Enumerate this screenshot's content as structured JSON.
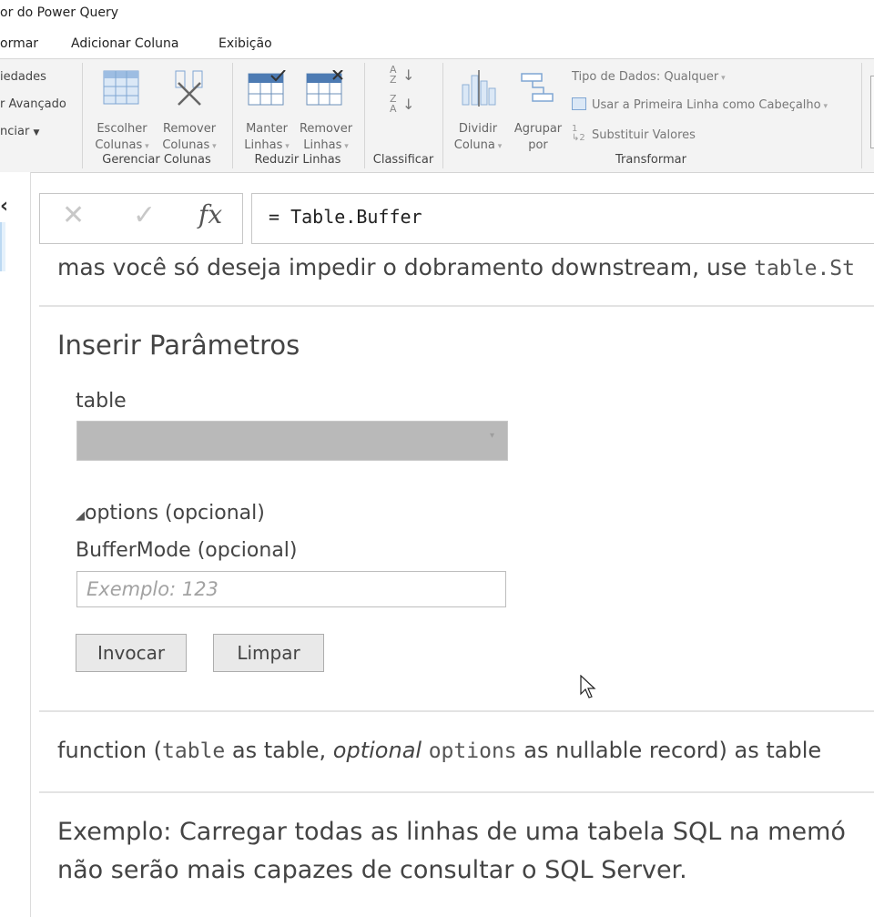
{
  "window": {
    "title": "or do Power Query"
  },
  "menu": {
    "items": [
      "ormar",
      "Adicionar Coluna",
      "Exibição"
    ]
  },
  "ribbon": {
    "left_partial": [
      "iedades",
      "r Avançado",
      "nciar"
    ],
    "choose_columns": {
      "line1": "Escolher",
      "line2": "Colunas"
    },
    "remove_columns": {
      "line1": "Remover",
      "line2": "Colunas"
    },
    "keep_rows": {
      "line1": "Manter",
      "line2": "Linhas"
    },
    "remove_rows": {
      "line1": "Remover",
      "line2": "Linhas"
    },
    "split_column": {
      "line1": "Dividir",
      "line2": "Coluna"
    },
    "group_by": {
      "line1": "Agrupar",
      "line2": "por"
    },
    "data_type": "Tipo de Dados: Qualquer",
    "use_first_row": "Usar a Primeira Linha como Cabeçalho",
    "replace_values": "Substituir Valores",
    "groups": {
      "manage_columns": "Gerenciar Colunas",
      "reduce_rows": "Reduzir Linhas",
      "sort": "Classificar",
      "transform": "Transformar"
    }
  },
  "formula": {
    "prefix": "=",
    "text": "Table.Buffer"
  },
  "description": {
    "text": "mas você só deseja impedir o dobramento downstream, use",
    "code": "table.St"
  },
  "params": {
    "heading": "Inserir Parâmetros",
    "table_label": "table",
    "options_toggle": "options (opcional)",
    "buffermode_label": "BufferMode (opcional)",
    "buffermode_placeholder": "Exemplo: 123",
    "invoke_label": "Invocar",
    "clear_label": "Limpar"
  },
  "signature": {
    "p1": "function (",
    "c1": "table",
    "p2": " as table, ",
    "optional": "optional",
    "p3": " ",
    "c2": "options",
    "p4": " as nullable record) as table"
  },
  "example": {
    "line1": "Exemplo: Carregar todas as linhas de uma tabela SQL na memó",
    "line2": "não serão mais capazes de consultar o SQL Server."
  },
  "colors": {
    "ribbon_bg": "#f3f3f3",
    "icon_blue": "#5b8fc9",
    "dropdown_disabled": "#b9b9b9"
  }
}
